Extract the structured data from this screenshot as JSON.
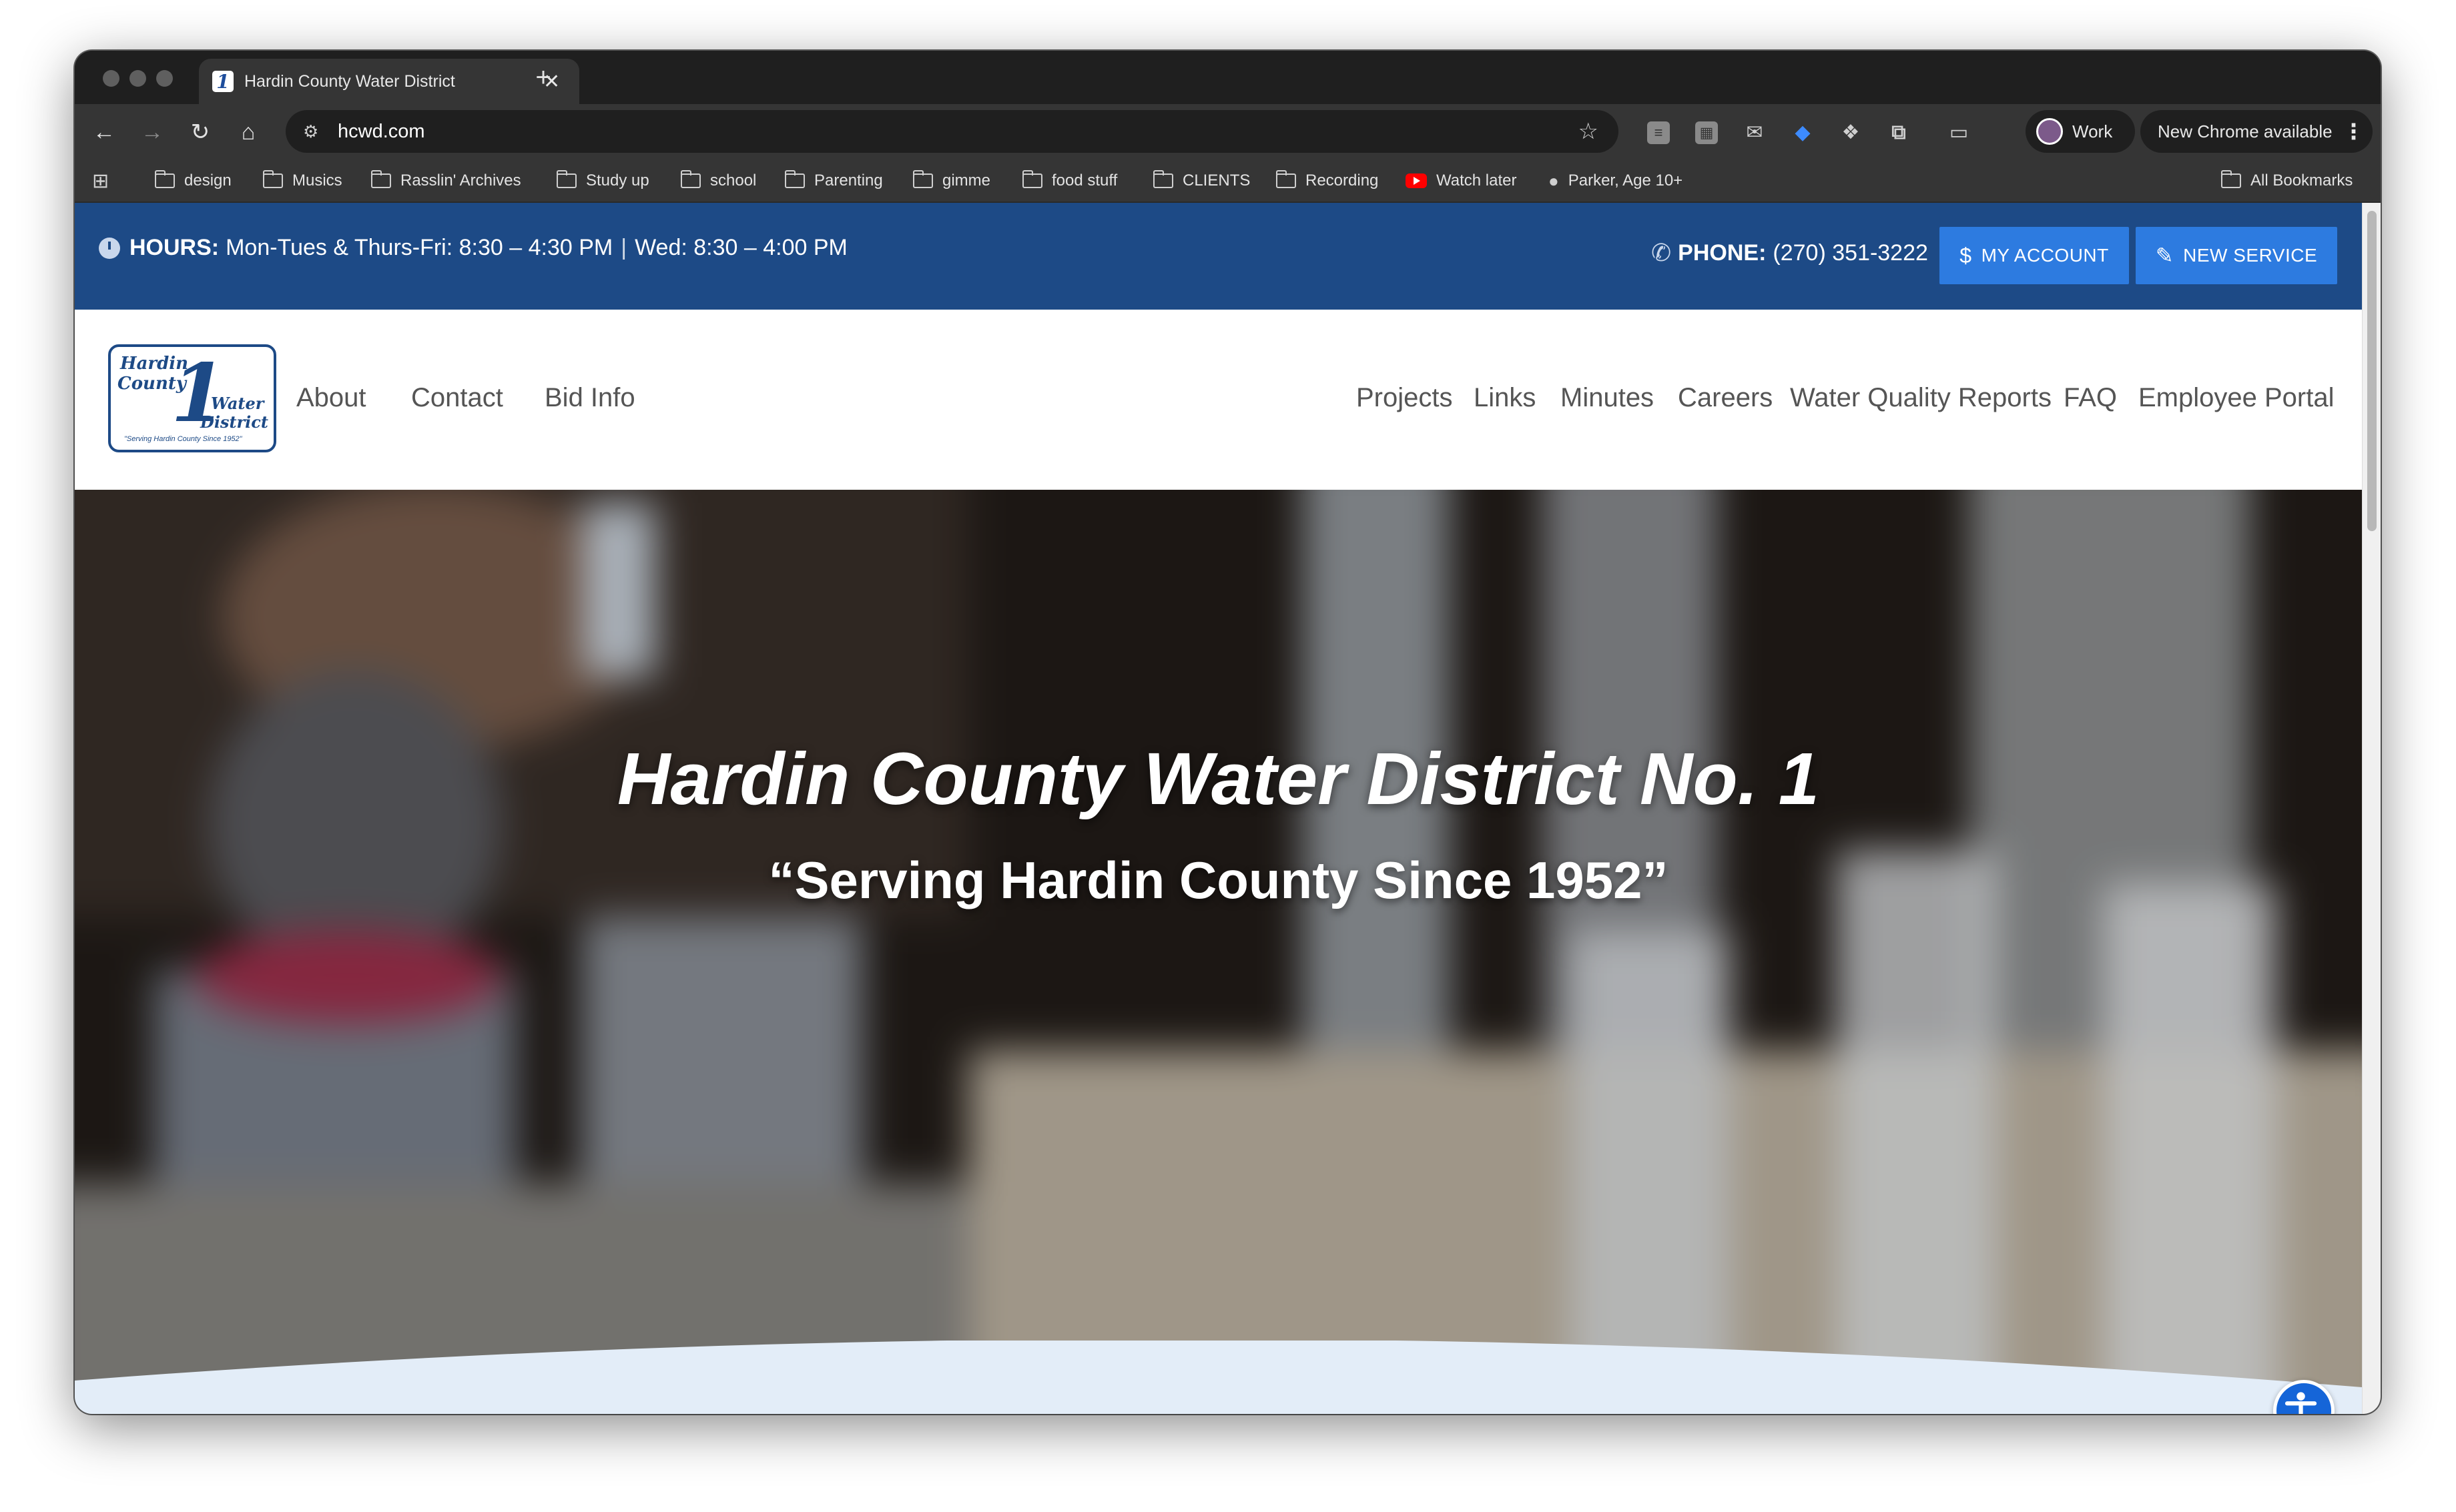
{
  "browser": {
    "tab_title": "Hardin County Water District",
    "tab_favicon": "1",
    "url": "hcwd.com",
    "profile_label": "Work",
    "update_label": "New Chrome available",
    "bookmarks": [
      "design",
      "Musics",
      "Rasslin' Archives",
      "Study up",
      "school",
      "Parenting",
      "gimme",
      "food stuff",
      "CLIENTS",
      "Recording",
      "Watch later",
      "Parker, Age 10+"
    ],
    "all_bookmarks": "All Bookmarks"
  },
  "topbar": {
    "hours_label": "HOURS:",
    "hours_weekday": "Mon-Tues & Thurs-Fri: 8:30 – 4:30 PM",
    "hours_sep": "|",
    "hours_wed": "Wed: 8:30 – 4:00 PM",
    "phone_label": "PHONE:",
    "phone_number": "(270) 351-3222",
    "my_account": "MY ACCOUNT",
    "new_service": "NEW SERVICE",
    "accent_color": "#2d7be0",
    "bar_color": "#1d4a86"
  },
  "logo": {
    "line1": "Hardin",
    "line2": "County",
    "numeral": "1",
    "line3": "Water",
    "line4": "District",
    "tagline": "\"Serving Hardin County Since 1952\""
  },
  "nav": {
    "left": [
      "About",
      "Contact",
      "Bid Info"
    ],
    "right": [
      "Projects",
      "Links",
      "Minutes",
      "Careers",
      "Water Quality Reports",
      "FAQ",
      "Employee Portal"
    ]
  },
  "hero": {
    "title": "Hardin County Water District No. 1",
    "subtitle": "“Serving Hardin County Since 1952”"
  }
}
